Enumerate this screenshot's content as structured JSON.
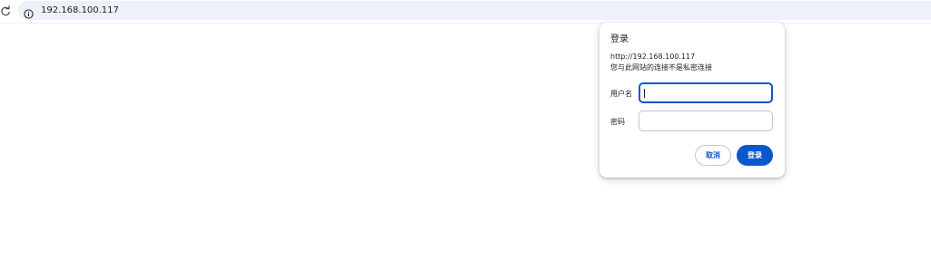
{
  "browser": {
    "address_bar": {
      "url": "192.168.100.117"
    },
    "icons": {
      "reload": "reload-icon",
      "site_info": "info-icon"
    }
  },
  "auth_dialog": {
    "title": "登录",
    "origin": "http://192.168.100.117",
    "warning": "您与此网站的连接不是私密连接",
    "username_label": "用户名",
    "username_value": "",
    "password_label": "密码",
    "password_value": "",
    "cancel_label": "取消",
    "login_label": "登录"
  },
  "colors": {
    "accent": "#0b57d0",
    "omnibox_bg": "#edf1f9",
    "text": "#1f1f1f",
    "border": "#c4c7c5"
  }
}
